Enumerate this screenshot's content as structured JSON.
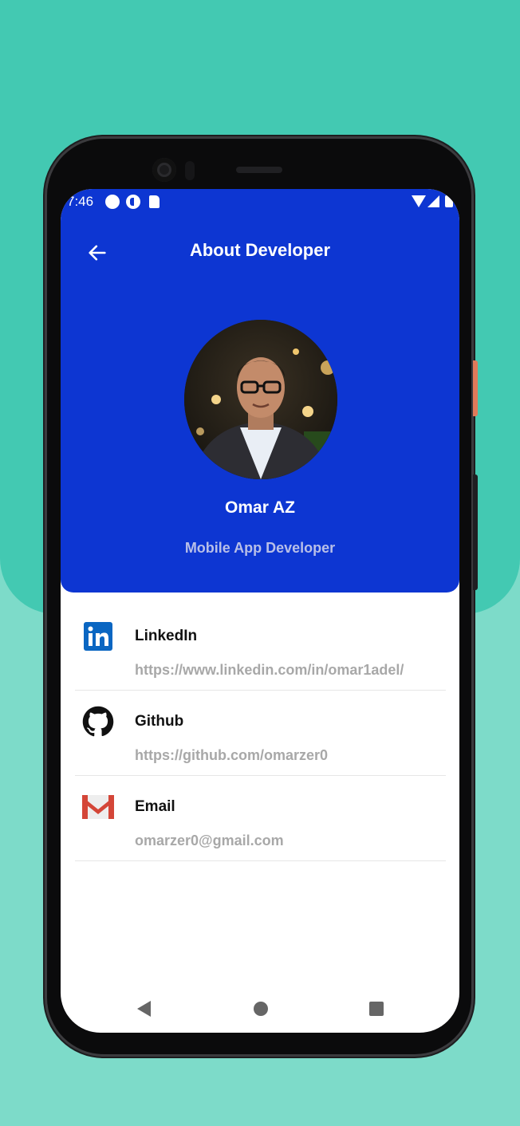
{
  "status_bar": {
    "time": "7:46",
    "icons": [
      "circle-icon",
      "half-circle-icon",
      "sd-card-icon",
      "wifi-icon",
      "signal-icon",
      "battery-icon"
    ]
  },
  "app_bar": {
    "title": "About Developer",
    "back_icon": "arrow-left-icon"
  },
  "profile": {
    "name": "Omar AZ",
    "role": "Mobile App Developer"
  },
  "contacts": [
    {
      "icon": "linkedin-icon",
      "title": "LinkedIn",
      "value": "https://www.linkedin.com/in/omar1adel/"
    },
    {
      "icon": "github-icon",
      "title": "Github",
      "value": "https://github.com/omarzer0"
    },
    {
      "icon": "gmail-icon",
      "title": "Email",
      "value": "omarzer0@gmail.com"
    }
  ],
  "nav_bar": {
    "icons": [
      "back-triangle-icon",
      "home-circle-icon",
      "recents-square-icon"
    ]
  },
  "colors": {
    "background_top": "#43c9b2",
    "background_bottom": "#7ddbc9",
    "header": "#0d36d2",
    "linkedin": "#0a66c2",
    "gmail_red": "#d44638"
  }
}
